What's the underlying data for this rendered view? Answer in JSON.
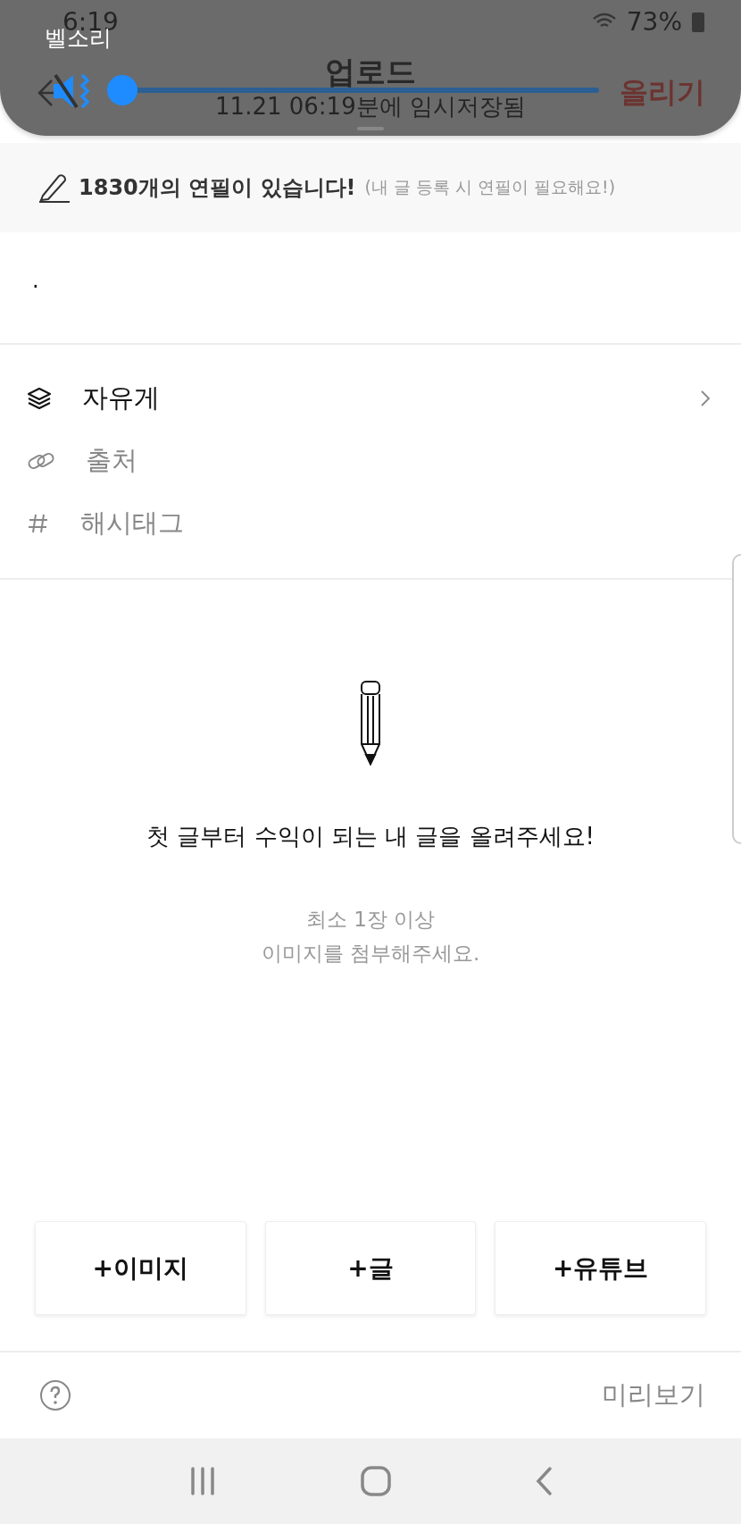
{
  "status_bar": {
    "time": "6:19",
    "battery": "73%"
  },
  "header": {
    "title": "업로드",
    "subtitle": "11.21 06:19분에 임시저장됨",
    "action": "올리기"
  },
  "volume_panel": {
    "label": "벨소리",
    "muted": true,
    "level": 0
  },
  "pencil_banner": {
    "count_text": "1830개의 연필이 있습니다!",
    "note": "(내 글 등록 시 연필이 필요해요!)"
  },
  "body_text": ".",
  "options": [
    {
      "kind": "category",
      "label": "자유게",
      "filled": true
    },
    {
      "kind": "source",
      "label": "출처",
      "filled": false
    },
    {
      "kind": "hashtag",
      "label": "해시태그",
      "filled": false
    }
  ],
  "empty_state": {
    "heading": "첫 글부터 수익이 되는 내 글을 올려주세요!",
    "hint_lines": [
      "최소 1장 이상",
      "이미지를 첨부해주세요."
    ]
  },
  "add_buttons": [
    "+이미지",
    "+글",
    "+유튜브"
  ],
  "footer": {
    "preview": "미리보기"
  }
}
